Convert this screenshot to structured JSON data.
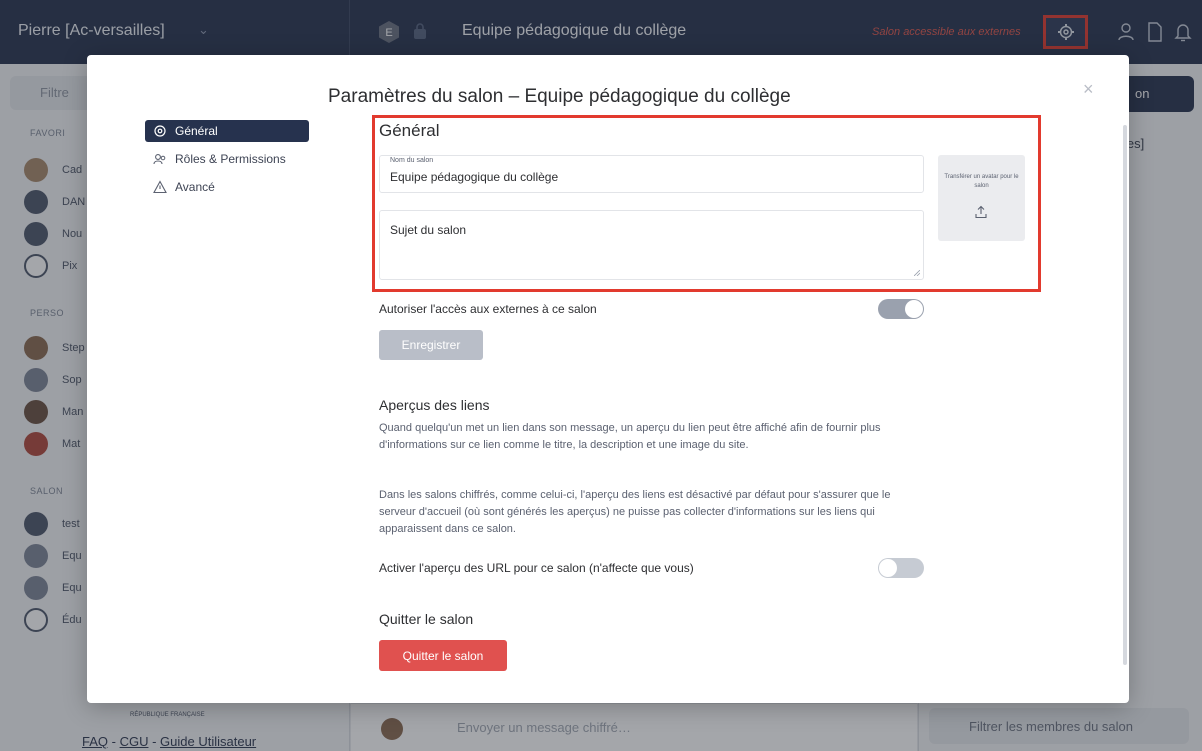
{
  "topbar": {
    "user_name": "Pierre [Ac-versailles]",
    "user_chevron": "⌄",
    "room_avatar_letter": "E",
    "room_title": "Equipe pédagogique du collège",
    "external_label": "Salon accessible aux externes"
  },
  "sidebar": {
    "filter_placeholder": "Filtre",
    "sections": [
      "FAVORI",
      "PERSO",
      "SALON"
    ],
    "favorites": [
      "Cad",
      "DAN",
      "Nou",
      "Pix"
    ],
    "people": [
      "Step",
      "Sop",
      "Man",
      "Mat"
    ],
    "rooms": [
      "test",
      "Equ",
      "Equ",
      "Édu"
    ],
    "gouv_label": "RÉPUBLIQUE FRANÇAISE",
    "footer_links": [
      "FAQ",
      "CGU",
      "Guide Utilisateur"
    ],
    "footer_sep": " - "
  },
  "main": {
    "composer_placeholder": "Envoyer un message chiffré…"
  },
  "right_panel": {
    "invite_label": "on",
    "members_label": "les]",
    "filter_members": "Filtrer les membres du salon"
  },
  "dialog": {
    "title": "Paramètres du salon – Equipe pédagogique du collège",
    "close": "×",
    "tabs": [
      {
        "label": "Général",
        "icon": "gear-icon",
        "active": true
      },
      {
        "label": "Rôles & Permissions",
        "icon": "people-icon",
        "active": false
      },
      {
        "label": "Avancé",
        "icon": "warning-icon",
        "active": false
      }
    ],
    "general": {
      "heading": "Général",
      "name_label": "Nom du salon",
      "name_value": "Equipe pédagogique du collège",
      "topic_placeholder": "Sujet du salon",
      "avatar_upload": "Transférer un avatar pour le salon"
    },
    "external_access_label": "Autoriser l'accès aux externes à ce salon",
    "external_access_on": true,
    "save_label": "Enregistrer",
    "link_preview": {
      "heading": "Aperçus des liens",
      "para1": "Quand quelqu'un met un lien dans son message, un aperçu du lien peut être affiché afin de fournir plus d'informations sur ce lien comme le titre, la description et une image du site.",
      "para2": "Dans les salons chiffrés, comme celui-ci, l'aperçu des liens est désactivé par défaut pour s'assurer que le serveur d'accueil (où sont générés les aperçus) ne puisse pas collecter d'informations sur les liens qui apparaissent dans ce salon.",
      "toggle_label": "Activer l'aperçu des URL pour ce salon (n'affecte que vous)",
      "toggle_on": false
    },
    "leave": {
      "heading": "Quitter le salon",
      "button": "Quitter le salon"
    }
  },
  "colors": {
    "topbar": "#26324e",
    "highlight": "#e23a2e",
    "danger": "#e0514f",
    "active_tab": "#26324e"
  }
}
